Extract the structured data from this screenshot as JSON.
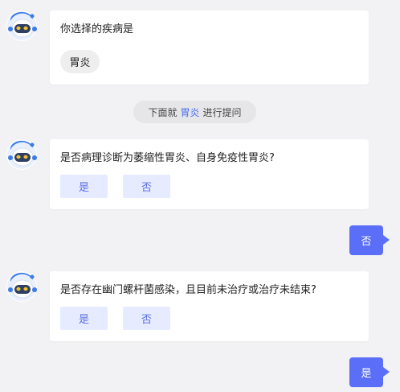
{
  "messages": {
    "m1": {
      "question": "你选择的疾病是",
      "chip": "胃炎"
    },
    "notice": {
      "prefix": "下面就",
      "highlight": "胃炎",
      "suffix": "进行提问"
    },
    "m2": {
      "question": "是否病理诊断为萎缩性胃炎、自身免疫性胃炎?",
      "yes": "是",
      "no": "否"
    },
    "reply1": "否",
    "m3": {
      "question": "是否存在幽门螺杆菌感染，且目前未治疗或治疗未结束?",
      "yes": "是",
      "no": "否"
    },
    "reply2": "是"
  },
  "colors": {
    "accent": "#5b6ef7",
    "option_bg": "#e6ebff",
    "option_text": "#5b6fe6",
    "highlight": "#4d6ef2"
  },
  "icons": {
    "bot_avatar": "robot-avatar-icon"
  }
}
